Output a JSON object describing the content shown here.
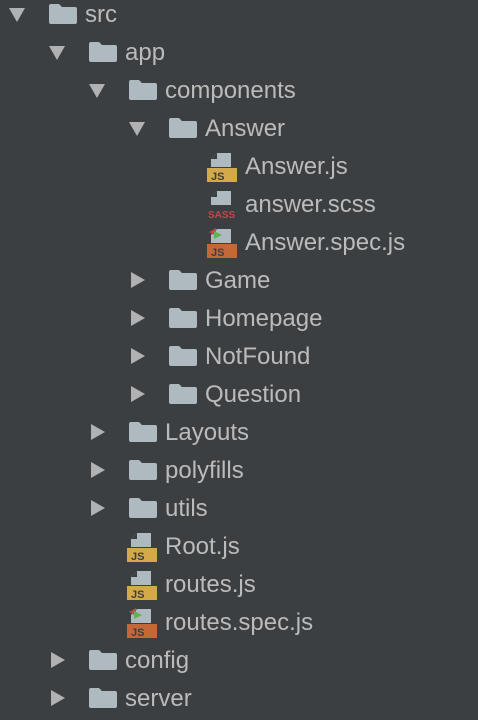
{
  "colors": {
    "background": "#3c3f41",
    "text": "#bbbbbb",
    "folder": "#aeb9c0",
    "arrow": "#afb1b3",
    "js_badge": "#d4a94a",
    "sass_badge": "#c2454b",
    "spec_badge": "#c4683a"
  },
  "tree": {
    "nodes": [
      {
        "label": "src",
        "state": "expanded",
        "icon": "folder-icon"
      },
      {
        "label": "app",
        "state": "expanded",
        "icon": "folder-icon"
      },
      {
        "label": "components",
        "state": "expanded",
        "icon": "folder-icon"
      },
      {
        "label": "Answer",
        "state": "expanded",
        "icon": "folder-icon"
      },
      {
        "label": "Answer.js",
        "state": "file",
        "icon": "js-file-icon",
        "badge": "JS"
      },
      {
        "label": "answer.scss",
        "state": "file",
        "icon": "sass-file-icon",
        "badge": "SASS"
      },
      {
        "label": "Answer.spec.js",
        "state": "file",
        "icon": "js-test-file-icon",
        "badge": "JS"
      },
      {
        "label": "Game",
        "state": "collapsed",
        "icon": "folder-icon"
      },
      {
        "label": "Homepage",
        "state": "collapsed",
        "icon": "folder-icon"
      },
      {
        "label": "NotFound",
        "state": "collapsed",
        "icon": "folder-icon"
      },
      {
        "label": "Question",
        "state": "collapsed",
        "icon": "folder-icon"
      },
      {
        "label": "Layouts",
        "state": "collapsed",
        "icon": "folder-icon"
      },
      {
        "label": "polyfills",
        "state": "collapsed",
        "icon": "folder-icon"
      },
      {
        "label": "utils",
        "state": "collapsed",
        "icon": "folder-icon"
      },
      {
        "label": "Root.js",
        "state": "file",
        "icon": "js-file-icon",
        "badge": "JS"
      },
      {
        "label": "routes.js",
        "state": "file",
        "icon": "js-file-icon",
        "badge": "JS"
      },
      {
        "label": "routes.spec.js",
        "state": "file",
        "icon": "js-test-file-icon",
        "badge": "JS"
      },
      {
        "label": "config",
        "state": "collapsed",
        "icon": "folder-icon"
      },
      {
        "label": "server",
        "state": "collapsed",
        "icon": "folder-icon"
      }
    ]
  }
}
